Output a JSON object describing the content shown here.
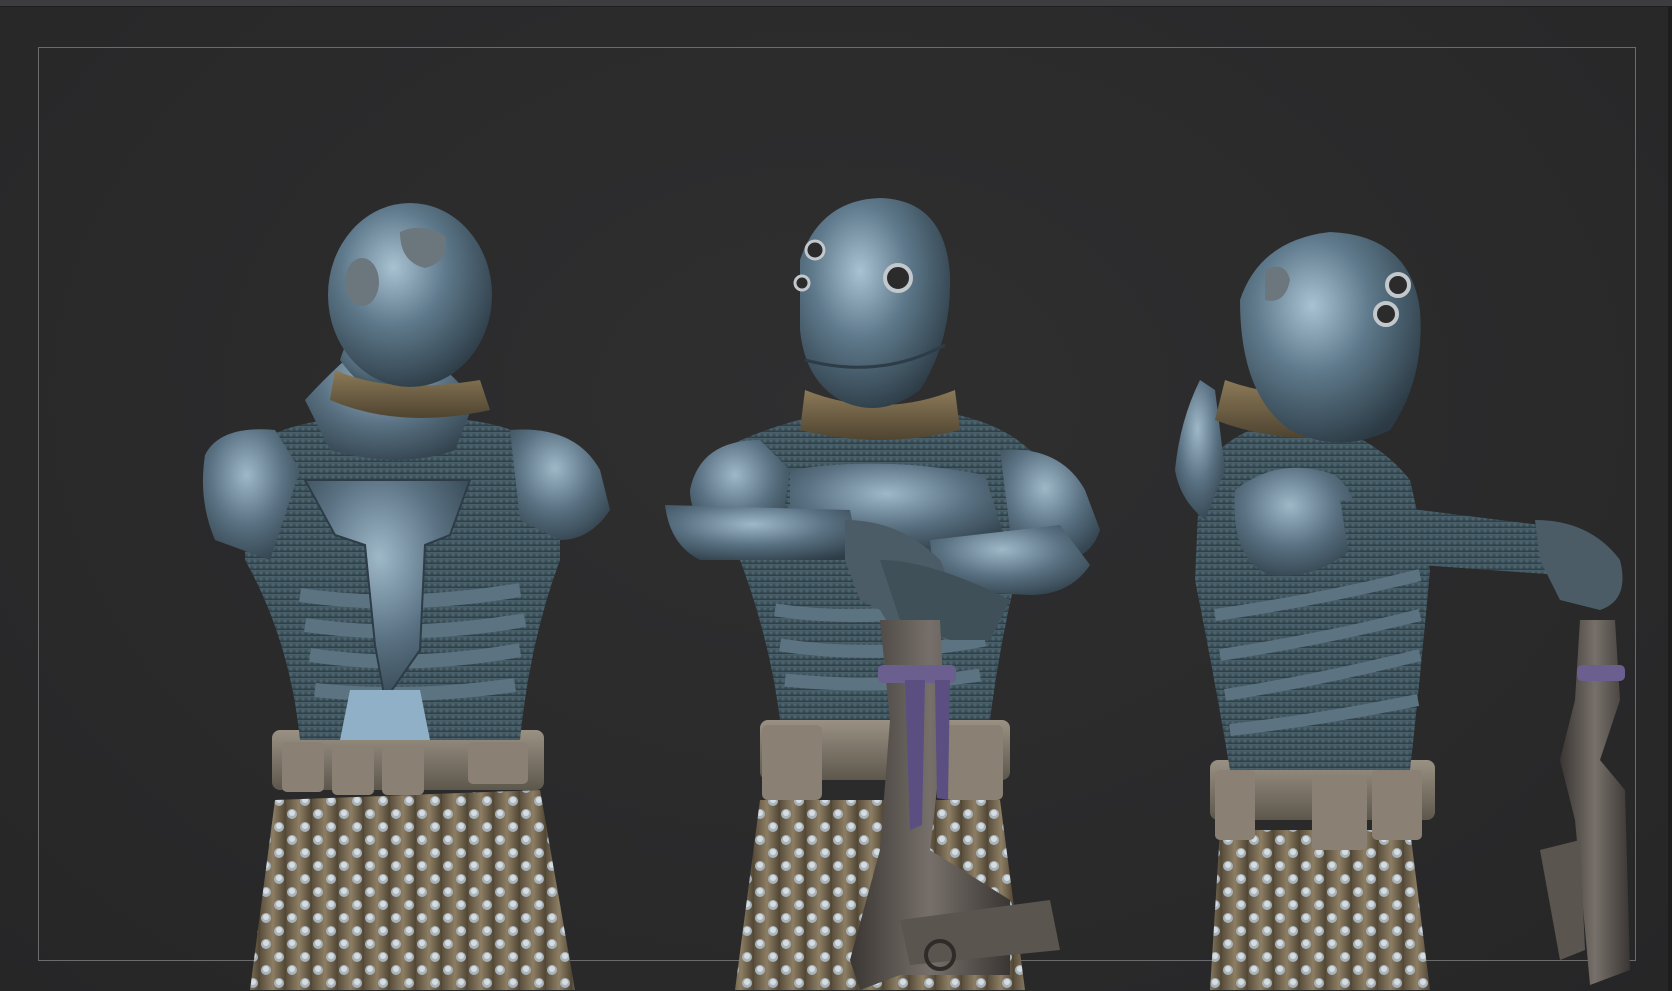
{
  "app": {
    "canvas": {
      "background_color": "#2b2b2c",
      "frame_color": "#6b6b6d"
    },
    "model": {
      "armor_color": "#5a7283",
      "suit_color": "#3b4e57",
      "scarf_color": "#7a6a4d",
      "skirt_color": "#7f715a",
      "belt_color": "#7a7368",
      "strap_color": "#6b5f8f",
      "views": [
        {
          "id": "back-view"
        },
        {
          "id": "front-view"
        },
        {
          "id": "side-view"
        }
      ]
    }
  }
}
